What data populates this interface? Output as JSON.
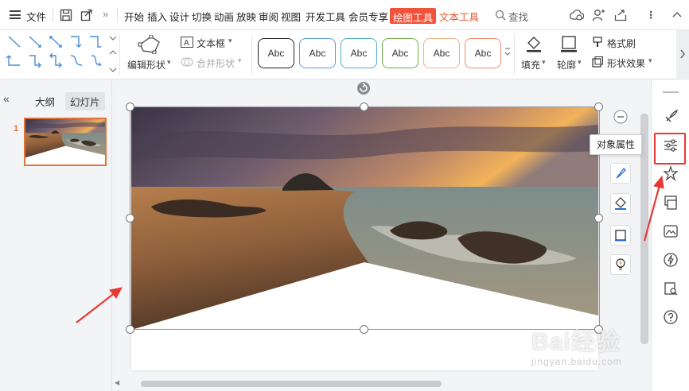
{
  "menubar": {
    "file": "文件",
    "tabs": [
      "开始",
      "插入",
      "设计",
      "切换",
      "动画",
      "放映",
      "审阅",
      "视图",
      "开发工具",
      "会员专享"
    ],
    "active_tab": "绘图工具",
    "text_tools": "文本工具",
    "search": "查找"
  },
  "ribbon": {
    "edit_shape": "编辑形状",
    "text_box": "文本框",
    "merge_shapes": "合并形状",
    "style_label": "Abc",
    "style_colors": [
      "#222222",
      "#5b9bd5",
      "#4bacc6",
      "#70ad47",
      "#f4b183",
      "#f08a6b"
    ],
    "fill": "填充",
    "outline": "轮廓",
    "format_painter": "格式刷",
    "shape_effects": "形状效果"
  },
  "left_panel": {
    "tab_outline": "大纲",
    "tab_slides": "幻灯片",
    "slide_number": "1"
  },
  "tooltip": "对象属性",
  "watermark": {
    "logo": "Bai经验",
    "url": "jingyan.baidu.com"
  },
  "colors": {
    "accent": "#f0533b",
    "thumb_border": "#e0743a",
    "highlight": "#e53935"
  }
}
